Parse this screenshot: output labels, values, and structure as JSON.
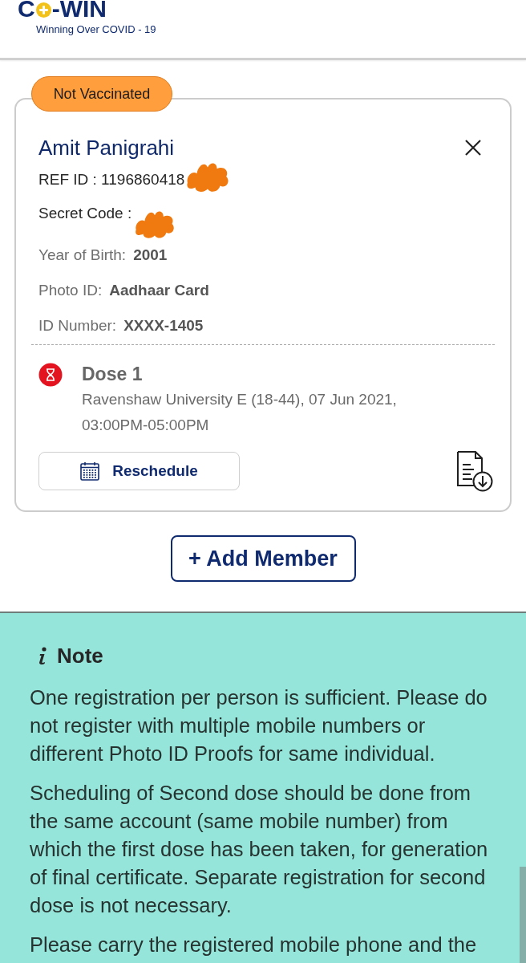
{
  "header": {
    "logo_left": "C",
    "logo_right": "-WIN",
    "tagline": "Winning Over COVID - 19"
  },
  "member_card": {
    "status_badge": "Not Vaccinated",
    "name": "Amit Panigrahi",
    "ref_id": "REF ID : 1196860418",
    "secret_code": "Secret Code :",
    "details": [
      {
        "label": "Year of Birth:",
        "value": "2001"
      },
      {
        "label": "Photo ID:",
        "value": "Aadhaar Card"
      },
      {
        "label": "ID Number:",
        "value": "XXXX-1405"
      }
    ],
    "dose": {
      "title": "Dose 1",
      "details": "Ravenshaw University E (18-44), 07 Jun 2021, 03:00PM-05:00PM"
    },
    "reschedule_button": "Reschedule"
  },
  "add_member_button": "+ Add Member",
  "note": {
    "title": "Note",
    "paragraphs": [
      "One registration per person is sufficient. Please do not register with multiple mobile numbers or different Photo ID Proofs for same individual.",
      "Scheduling of Second dose should be done from the same account (same mobile number) from which the first dose has been taken, for generation of final certificate. Separate registration for second dose is not necessary.",
      "Please carry the registered mobile phone and the"
    ]
  }
}
